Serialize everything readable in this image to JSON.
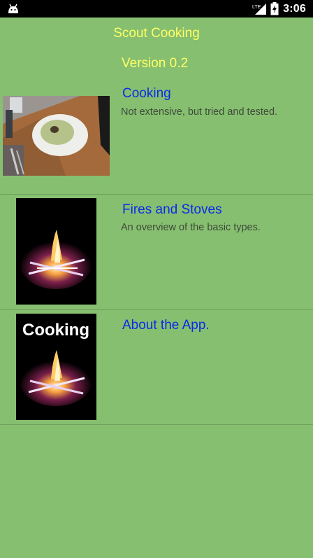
{
  "status_bar": {
    "network": "LTE",
    "time": "3:06",
    "icons": [
      "android-icon",
      "signal-icon",
      "battery-charging-icon"
    ]
  },
  "header": {
    "title": "Scout Cooking",
    "version": "Version 0.2"
  },
  "items": [
    {
      "title": "Cooking",
      "subtitle": "Not extensive, but tried and tested.",
      "image": "cooking-table-photo"
    },
    {
      "title": "Fires and Stoves",
      "subtitle": "An overview of the basic types.",
      "image": "campfire-photo"
    },
    {
      "title": "About the App.",
      "subtitle": "",
      "image": "cooking-campfire-logo",
      "image_text": "Cooking"
    }
  ],
  "colors": {
    "background": "#86BF70",
    "header_text": "#FFFF66",
    "item_title": "#0A2BE8",
    "item_subtitle": "#3E4A3A"
  }
}
